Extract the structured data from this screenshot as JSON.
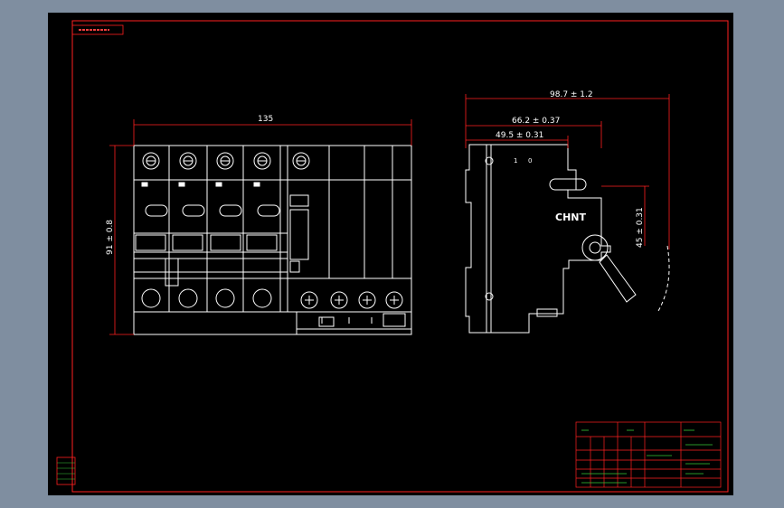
{
  "colors": {
    "background": "#7f8ea0",
    "sheet": "#000000",
    "frame": "#ff2020",
    "outline": "#ffffff",
    "dimension": "#ff2020",
    "titleblock_text": "#36c836"
  },
  "icons": [
    "terminal-screw-icon",
    "brand-logo-icon",
    "test-button-icon"
  ],
  "front_view": {
    "width_dim": "135",
    "height_dim": "91 ± 0.8"
  },
  "side_view": {
    "dim_overall": "98.7 ± 1.2",
    "dim_middle": "66.2 ± 0.37",
    "dim_inner": "49.5 ± 0.31",
    "dim_handle": "45 ± 0.31",
    "brand": "CHNT",
    "pole_marks": [
      "1",
      "0"
    ]
  }
}
